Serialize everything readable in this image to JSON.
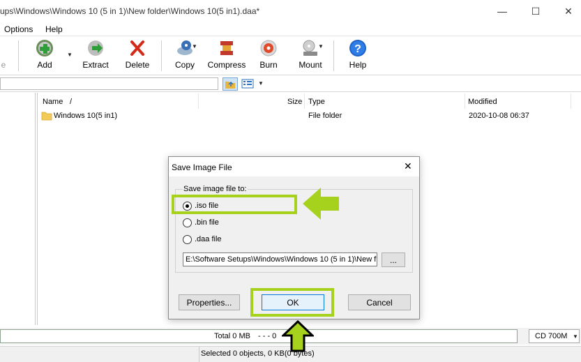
{
  "window": {
    "title": "ups\\Windows\\Windows 10 (5 in 1)\\New folder\\Windows 10(5 in1).daa*",
    "minimize": "—",
    "maximize": "☐",
    "close": "✕"
  },
  "menu": {
    "options": "Options",
    "help": "Help"
  },
  "toolbar": {
    "items": [
      {
        "label": "e"
      },
      {
        "label": "Add"
      },
      {
        "label": "Extract"
      },
      {
        "label": "Delete"
      },
      {
        "label": "Copy"
      },
      {
        "label": "Compress"
      },
      {
        "label": "Burn"
      },
      {
        "label": "Mount"
      },
      {
        "label": "Help"
      }
    ]
  },
  "columns": {
    "name": "Name",
    "sort": "/",
    "size": "Size",
    "type": "Type",
    "modified": "Modified"
  },
  "files": [
    {
      "name": "Windows 10(5 in1)",
      "size": "",
      "type": "File folder",
      "modified": "2020-10-08 06:37"
    }
  ],
  "status": {
    "total": "Total  0 MB",
    "dashes": "- - -  0",
    "media": "CD 700M",
    "selected": "Selected 0 objects, 0 KB(0 bytes)"
  },
  "dialog": {
    "title": "Save Image File",
    "close": "✕",
    "group_label": "Save image file to:",
    "options": [
      {
        "label": ".iso file",
        "checked": true
      },
      {
        "label": ".bin file",
        "checked": false
      },
      {
        "label": ".daa file",
        "checked": false
      }
    ],
    "path_value": "E:\\Software Setups\\Windows\\Windows 10 (5 in 1)\\New f",
    "browse": "...",
    "properties": "Properties...",
    "ok": "OK",
    "cancel": "Cancel"
  },
  "colors": {
    "highlight": "#a6d21d",
    "arrow": "#a6d21d"
  }
}
